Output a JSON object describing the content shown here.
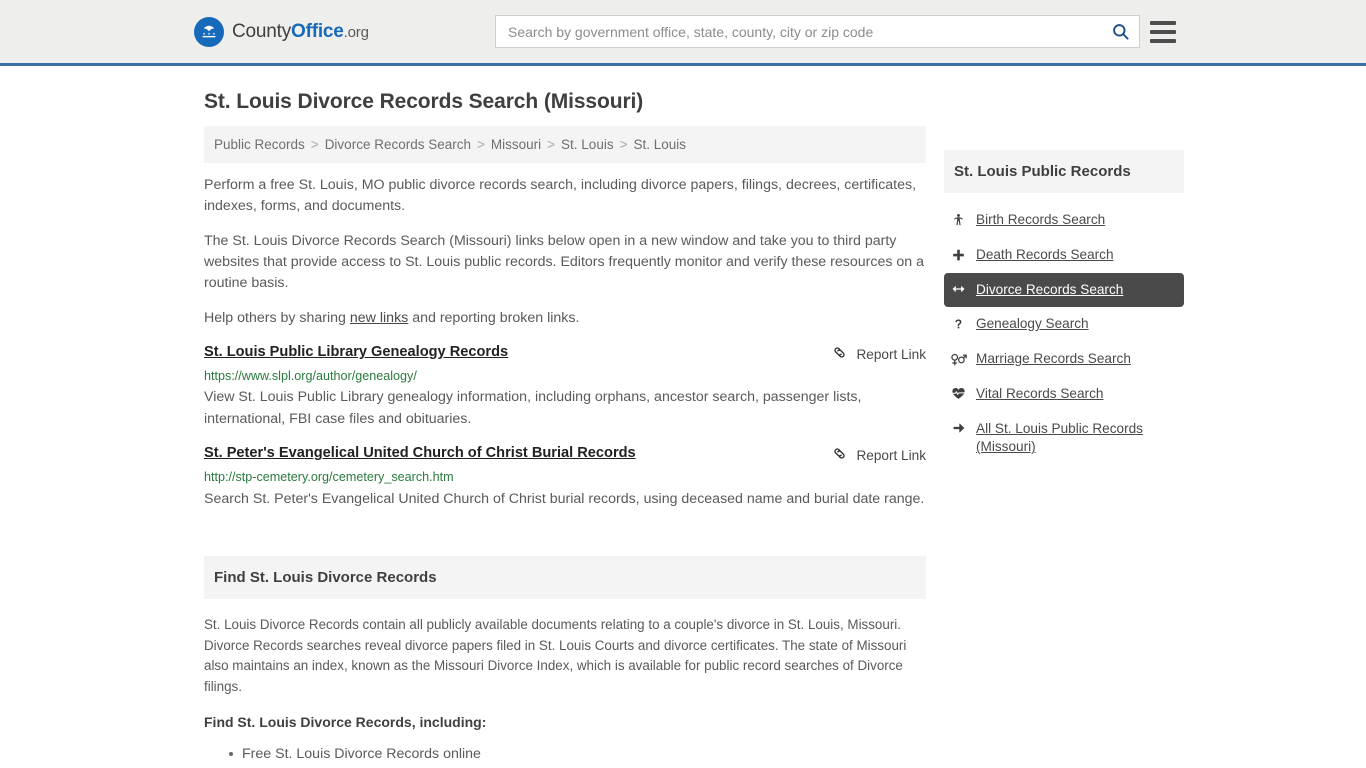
{
  "header": {
    "brand": {
      "part1": "County",
      "part2": "Office",
      "part3": ".org",
      "logo_icon": "eagle-shield-logo"
    },
    "search": {
      "placeholder": "Search by government office, state, county, city or zip code",
      "value": "",
      "icon": "search-icon"
    },
    "menu_icon": "hamburger-menu-icon",
    "accent_color": "#3a72a8"
  },
  "page": {
    "title": "St. Louis Divorce Records Search (Missouri)",
    "breadcrumb": [
      "Public Records",
      "Divorce Records Search",
      "Missouri",
      "St. Louis",
      "St. Louis"
    ],
    "breadcrumb_separator": ">",
    "paragraphs": [
      "Perform a free St. Louis, MO public divorce records search, including divorce papers, filings, decrees, certificates, indexes, forms, and documents.",
      "The St. Louis Divorce Records Search (Missouri) links below open in a new window and take you to third party websites that provide access to St. Louis public records. Editors frequently monitor and verify these resources on a routine basis."
    ],
    "help_line": {
      "before": "Help others by sharing ",
      "link": "new links",
      "after": " and reporting broken links."
    }
  },
  "results": {
    "report_label": "Report Link",
    "report_icon": "broken-link-icon",
    "items": [
      {
        "title": "St. Louis Public Library Genealogy Records",
        "url": "https://www.slpl.org/author/genealogy/",
        "description": "View St. Louis Public Library genealogy information, including orphans, ancestor search, passenger lists, international, FBI case files and obituaries."
      },
      {
        "title": "St. Peter's Evangelical United Church of Christ Burial Records",
        "url": "http://stp-cemetery.org/cemetery_search.htm",
        "description": "Search St. Peter's Evangelical United Church of Christ burial records, using deceased name and burial date range."
      }
    ]
  },
  "section": {
    "heading": "Find St. Louis Divorce Records",
    "body": "St. Louis Divorce Records contain all publicly available documents relating to a couple's divorce in St. Louis, Missouri. Divorce Records searches reveal divorce papers filed in St. Louis Courts and divorce certificates. The state of Missouri also maintains an index, known as the Missouri Divorce Index, which is available for public record searches of Divorce filings.",
    "list_heading": "Find St. Louis Divorce Records, including:",
    "list_items": [
      "Free St. Louis Divorce Records online"
    ]
  },
  "sidebar": {
    "heading": "St. Louis Public Records",
    "active_bg": "#4a4a4a",
    "items": [
      {
        "label": "Birth Records Search",
        "icon": "child-icon",
        "active": false
      },
      {
        "label": "Death Records Search",
        "icon": "cross-plus-icon",
        "active": false
      },
      {
        "label": "Divorce Records Search",
        "icon": "left-right-arrows-icon",
        "active": true
      },
      {
        "label": "Genealogy Search",
        "icon": "question-mark-icon",
        "active": false
      },
      {
        "label": "Marriage Records Search",
        "icon": "venus-mars-icon",
        "active": false
      },
      {
        "label": "Vital Records Search",
        "icon": "heart-pulse-icon",
        "active": false
      },
      {
        "label": "All St. Louis Public Records (Missouri)",
        "icon": "arrow-right-icon",
        "active": false
      }
    ]
  }
}
